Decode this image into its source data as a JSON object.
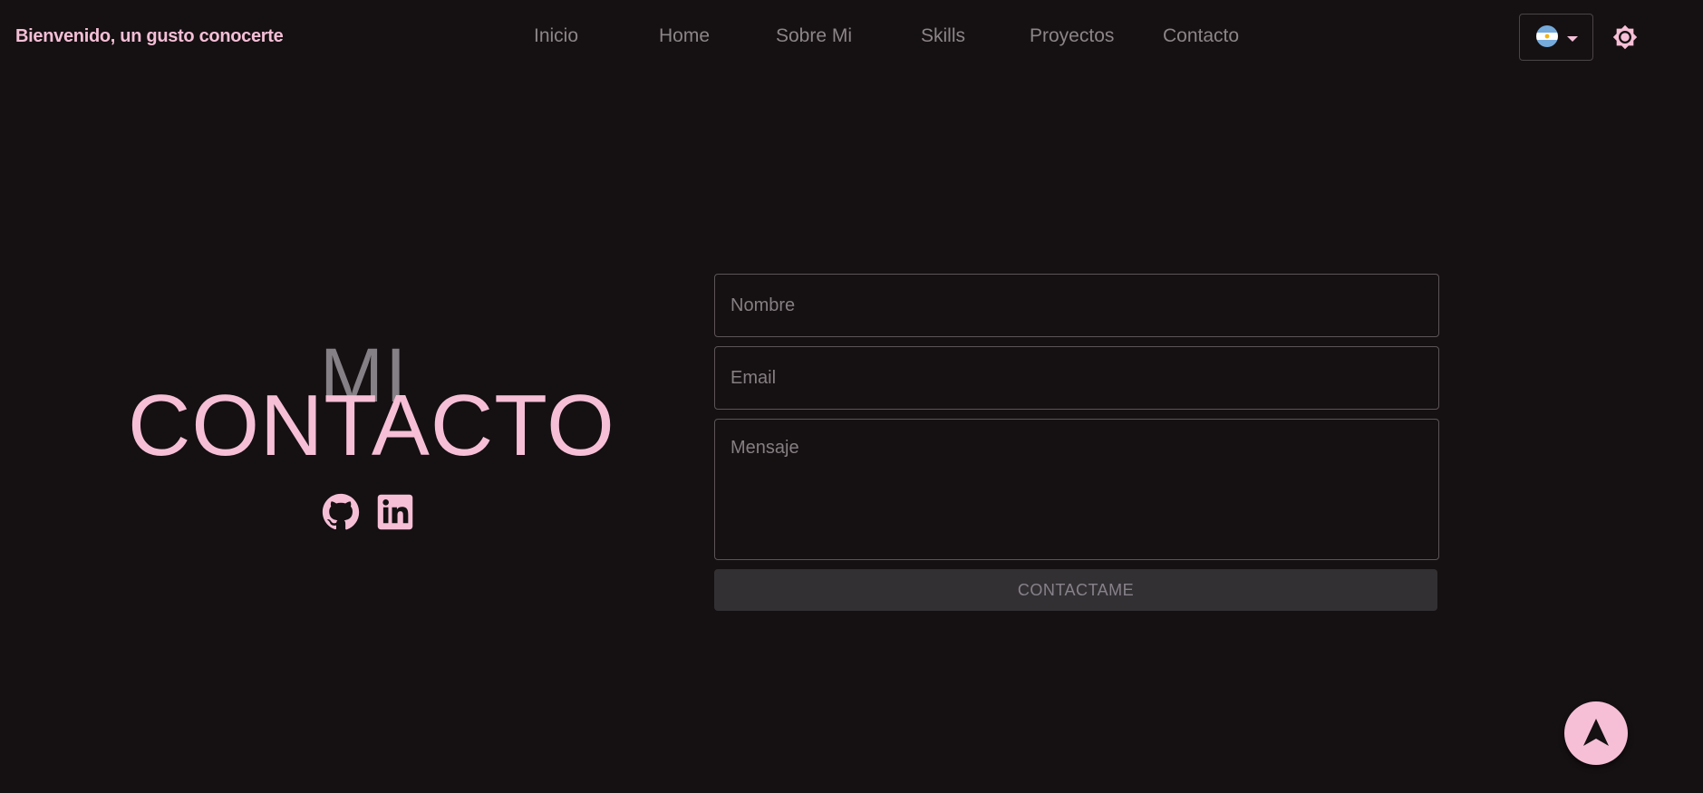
{
  "header": {
    "brand": "Bienvenido, un gusto conocerte",
    "nav": [
      {
        "label": "Inicio"
      },
      {
        "label": "Home"
      },
      {
        "label": "Sobre Mi"
      },
      {
        "label": "Skills"
      },
      {
        "label": "Proyectos"
      },
      {
        "label": "Contacto"
      }
    ],
    "language": {
      "icon": "argentina-flag-icon"
    },
    "theme_toggle": {
      "icon": "brightness-icon"
    }
  },
  "contact": {
    "title_small": "MI",
    "title_big": "CONTACTO",
    "social": [
      {
        "icon": "github-icon"
      },
      {
        "icon": "linkedin-icon"
      }
    ]
  },
  "form": {
    "name_placeholder": "Nombre",
    "email_placeholder": "Email",
    "message_placeholder": "Mensaje",
    "submit_label": "CONTACTAME"
  },
  "scroll_top": {
    "icon": "navigation-arrow-icon"
  },
  "colors": {
    "background": "#151012",
    "accent_pink": "#f6bfd6",
    "nav_text": "#8c8588",
    "muted_title": "#858085"
  }
}
